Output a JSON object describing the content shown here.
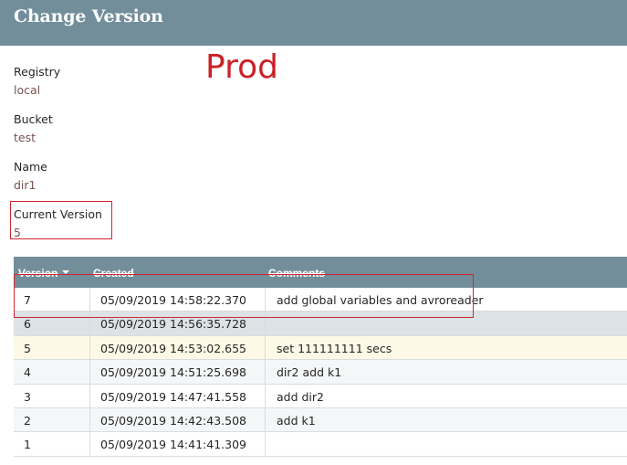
{
  "dialog": {
    "title": "Change Version"
  },
  "fields": {
    "registry": {
      "label": "Registry",
      "value": "local"
    },
    "bucket": {
      "label": "Bucket",
      "value": "test"
    },
    "name": {
      "label": "Name",
      "value": "dir1"
    },
    "current_version": {
      "label": "Current Version",
      "value": "5"
    }
  },
  "annotation": {
    "text": "Prod"
  },
  "table": {
    "headers": {
      "version": "Version",
      "created": "Created",
      "comments": "Comments"
    },
    "sort": {
      "column": "version",
      "direction": "descending"
    },
    "rows": [
      {
        "version": "7",
        "created": "05/09/2019 14:58:22.370",
        "comments": "add global variables and avroreader",
        "state": "white"
      },
      {
        "version": "6",
        "created": "05/09/2019 14:56:35.728",
        "comments": "",
        "state": "selected"
      },
      {
        "version": "5",
        "created": "05/09/2019 14:53:02.655",
        "comments": "set 111111111 secs",
        "state": "current"
      },
      {
        "version": "4",
        "created": "05/09/2019 14:51:25.698",
        "comments": "dir2 add k1",
        "state": "alt"
      },
      {
        "version": "3",
        "created": "05/09/2019 14:47:41.558",
        "comments": "add dir2",
        "state": "white"
      },
      {
        "version": "2",
        "created": "05/09/2019 14:42:43.508",
        "comments": "add k1",
        "state": "alt"
      },
      {
        "version": "1",
        "created": "05/09/2019 14:41:41.309",
        "comments": "",
        "state": "white"
      }
    ]
  },
  "colors": {
    "header_bg": "#728e9b",
    "value_text": "#775351",
    "annotation_red": "#cc2027",
    "selected_row": "#dce2e5",
    "current_row": "#fdf9e6"
  }
}
